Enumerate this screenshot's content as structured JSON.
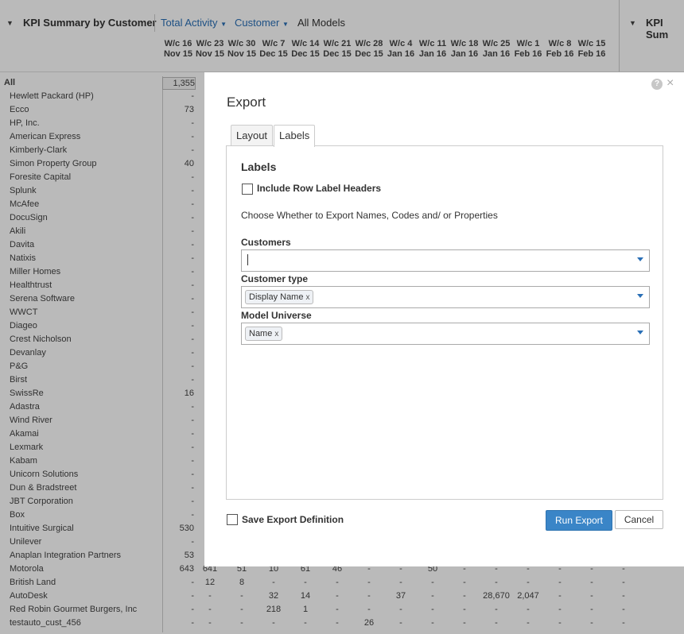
{
  "header": {
    "title": "KPI Summary by Customer",
    "menu_total_activity": "Total Activity",
    "menu_customer": "Customer",
    "menu_all_models": "All Models",
    "right_title": "KPI Sum"
  },
  "weeks": [
    {
      "l1": "W/c 16",
      "l2": "Nov 15"
    },
    {
      "l1": "W/c 23",
      "l2": "Nov 15"
    },
    {
      "l1": "W/c 30",
      "l2": "Nov 15"
    },
    {
      "l1": "W/c 7",
      "l2": "Dec 15"
    },
    {
      "l1": "W/c 14",
      "l2": "Dec 15"
    },
    {
      "l1": "W/c 21",
      "l2": "Dec 15"
    },
    {
      "l1": "W/c 28",
      "l2": "Dec 15"
    },
    {
      "l1": "W/c 4",
      "l2": "Jan 16"
    },
    {
      "l1": "W/c 11",
      "l2": "Jan 16"
    },
    {
      "l1": "W/c 18",
      "l2": "Jan 16"
    },
    {
      "l1": "W/c 25",
      "l2": "Jan 16"
    },
    {
      "l1": "W/c 1",
      "l2": "Feb 16"
    },
    {
      "l1": "W/c 8",
      "l2": "Feb 16"
    },
    {
      "l1": "W/c 15",
      "l2": "Feb 16"
    }
  ],
  "rows": [
    {
      "name": "All",
      "total": "1,355",
      "cells": []
    },
    {
      "name": "Hewlett Packard (HP)",
      "total": "-",
      "cells": []
    },
    {
      "name": "Ecco",
      "total": "73",
      "cells": []
    },
    {
      "name": "HP, Inc.",
      "total": "-",
      "cells": []
    },
    {
      "name": "American Express",
      "total": "-",
      "cells": []
    },
    {
      "name": "Kimberly-Clark",
      "total": "-",
      "cells": []
    },
    {
      "name": "Simon Property Group",
      "total": "40",
      "cells": []
    },
    {
      "name": "Foresite Capital",
      "total": "-",
      "cells": []
    },
    {
      "name": "Splunk",
      "total": "-",
      "cells": []
    },
    {
      "name": "McAfee",
      "total": "-",
      "cells": []
    },
    {
      "name": "DocuSign",
      "total": "-",
      "cells": []
    },
    {
      "name": "Akili",
      "total": "-",
      "cells": []
    },
    {
      "name": "Davita",
      "total": "-",
      "cells": []
    },
    {
      "name": "Natixis",
      "total": "-",
      "cells": []
    },
    {
      "name": "Miller Homes",
      "total": "-",
      "cells": []
    },
    {
      "name": "Healthtrust",
      "total": "-",
      "cells": []
    },
    {
      "name": "Serena Software",
      "total": "-",
      "cells": []
    },
    {
      "name": "WWCT",
      "total": "-",
      "cells": []
    },
    {
      "name": "Diageo",
      "total": "-",
      "cells": []
    },
    {
      "name": "Crest Nicholson",
      "total": "-",
      "cells": []
    },
    {
      "name": "Devanlay",
      "total": "-",
      "cells": []
    },
    {
      "name": "P&G",
      "total": "-",
      "cells": []
    },
    {
      "name": "Birst",
      "total": "-",
      "cells": []
    },
    {
      "name": "SwissRe",
      "total": "16",
      "cells": []
    },
    {
      "name": "Adastra",
      "total": "-",
      "cells": []
    },
    {
      "name": "Wind River",
      "total": "-",
      "cells": []
    },
    {
      "name": "Akamai",
      "total": "-",
      "cells": []
    },
    {
      "name": "Lexmark",
      "total": "-",
      "cells": []
    },
    {
      "name": "Kabam",
      "total": "-",
      "cells": []
    },
    {
      "name": "Unicorn Solutions",
      "total": "-",
      "cells": []
    },
    {
      "name": "Dun & Bradstreet",
      "total": "-",
      "cells": []
    },
    {
      "name": "JBT Corporation",
      "total": "-",
      "cells": []
    },
    {
      "name": "Box",
      "total": "-",
      "cells": []
    },
    {
      "name": "Intuitive Surgical",
      "total": "530",
      "cells": []
    },
    {
      "name": "Unilever",
      "total": "-",
      "cells": []
    },
    {
      "name": "Anaplan Integration Partners",
      "total": "53",
      "cells": []
    },
    {
      "name": "Motorola",
      "total": "643",
      "cells": [
        "641",
        "51",
        "10",
        "61",
        "46",
        "-",
        "-",
        "50",
        "-",
        "-",
        "-",
        "-",
        "-",
        "-"
      ]
    },
    {
      "name": "British Land",
      "total": "-",
      "cells": [
        "12",
        "8",
        "-",
        "-",
        "-",
        "-",
        "-",
        "-",
        "-",
        "-",
        "-",
        "-",
        "-",
        "-"
      ]
    },
    {
      "name": "AutoDesk",
      "total": "-",
      "cells": [
        "-",
        "-",
        "32",
        "14",
        "-",
        "-",
        "37",
        "-",
        "-",
        "28,670",
        "2,047",
        "-",
        "-",
        "-"
      ]
    },
    {
      "name": "Red Robin Gourmet Burgers, Inc",
      "total": "-",
      "cells": [
        "-",
        "-",
        "218",
        "1",
        "-",
        "-",
        "-",
        "-",
        "-",
        "-",
        "-",
        "-",
        "-",
        "-"
      ]
    },
    {
      "name": "testauto_cust_456",
      "total": "-",
      "cells": [
        "-",
        "-",
        "-",
        "-",
        "-",
        "26",
        "-",
        "-",
        "-",
        "-",
        "-",
        "-",
        "-",
        "-"
      ]
    }
  ],
  "dialog": {
    "title": "Export",
    "help": "?",
    "close": "×",
    "tabs": [
      "Layout",
      "Labels"
    ],
    "section_title": "Labels",
    "include_row_label_headers": "Include Row Label Headers",
    "description": "Choose Whether to Export Names, Codes and/ or Properties",
    "customers_label": "Customers",
    "customer_type_label": "Customer type",
    "customer_type_chip": "Display Name",
    "model_universe_label": "Model Universe",
    "model_universe_chip": "Name",
    "chip_remove": "x",
    "save_export_definition": "Save Export Definition",
    "run_export": "Run Export",
    "cancel": "Cancel"
  }
}
